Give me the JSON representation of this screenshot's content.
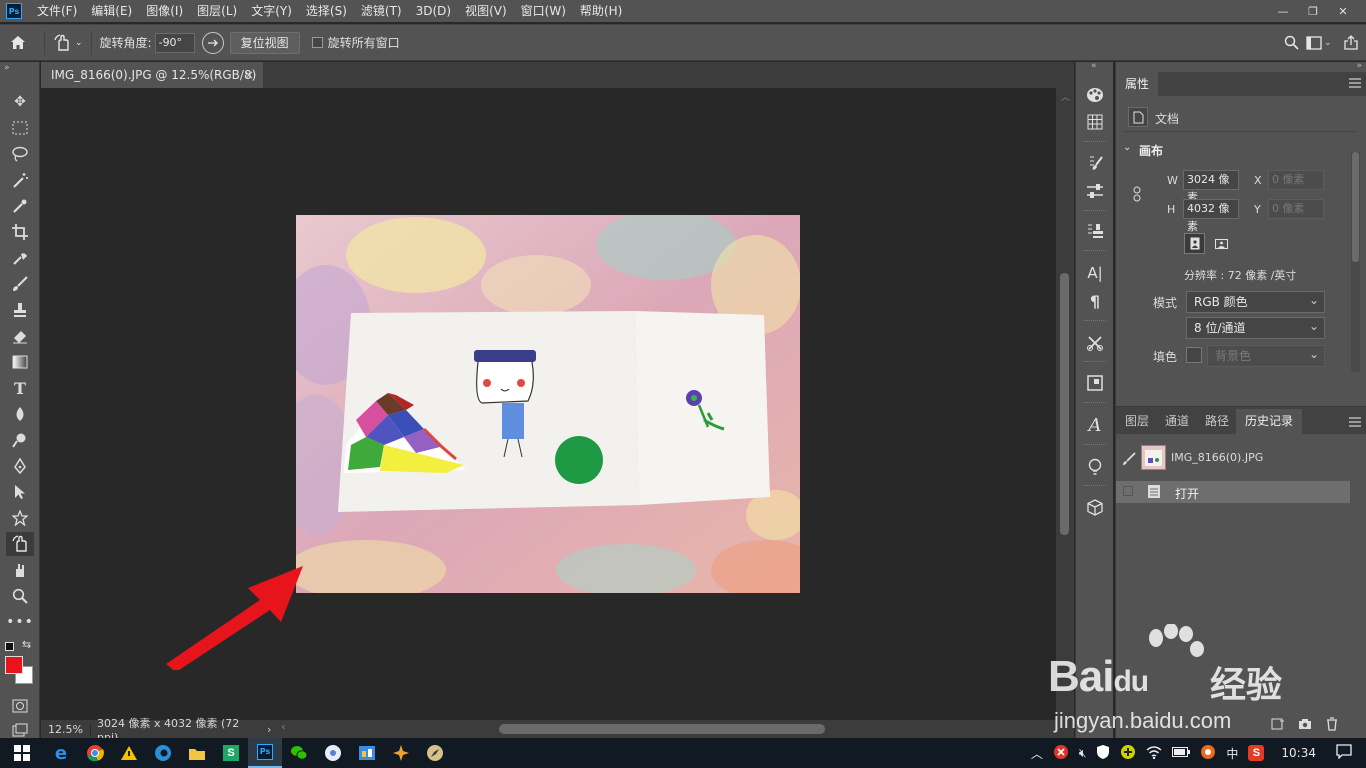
{
  "app": {
    "logo_text": "Ps"
  },
  "menu": [
    "文件(F)",
    "编辑(E)",
    "图像(I)",
    "图层(L)",
    "文字(Y)",
    "选择(S)",
    "滤镜(T)",
    "3D(D)",
    "视图(V)",
    "窗口(W)",
    "帮助(H)"
  ],
  "window_controls": {
    "minimize": "—",
    "restore": "❐",
    "close": "✕"
  },
  "options": {
    "rotate_angle_label": "旋转角度:",
    "rotate_angle_value": "-90°",
    "reset_view_label": "复位视图",
    "rotate_all_label": "旋转所有窗口"
  },
  "document": {
    "tab_title": "IMG_8166(0).JPG @ 12.5%(RGB/8) *",
    "close_glyph": "×",
    "zoom": "12.5%",
    "size_info": "3024 像素 x 4032 像素 (72 ppi)",
    "status_arrow": "›"
  },
  "properties": {
    "panel_title": "属性",
    "doc_label": "文档",
    "canvas_section": "画布",
    "w_label": "W",
    "w_value": "3024 像素",
    "h_label": "H",
    "h_value": "4032 像素",
    "x_label": "X",
    "x_placeholder": "0 像素",
    "y_label": "Y",
    "y_placeholder": "0 像素",
    "resolution": "分辨率 : 72 像素 /英寸",
    "mode_label": "模式",
    "mode_value": "RGB 颜色",
    "depth_value": "8 位/通道",
    "fill_label": "填色",
    "fill_value": "背景色"
  },
  "layers_tabs": [
    "图层",
    "通道",
    "路径",
    "历史记录"
  ],
  "history": {
    "snapshot_name": "IMG_8166(0).JPG",
    "items": [
      "打开"
    ]
  },
  "taskbar": {
    "time": "10:34",
    "ime": "中",
    "input_mode": "S"
  },
  "watermark": {
    "brand_latin": "Bai",
    "brand_du": "du",
    "brand_cn": "经验",
    "url": "jingyan.baidu.com"
  },
  "colors": {
    "accent_arrow": "#e8141b",
    "foreground_color": "#e8141b",
    "background_color": "#ffffff"
  }
}
